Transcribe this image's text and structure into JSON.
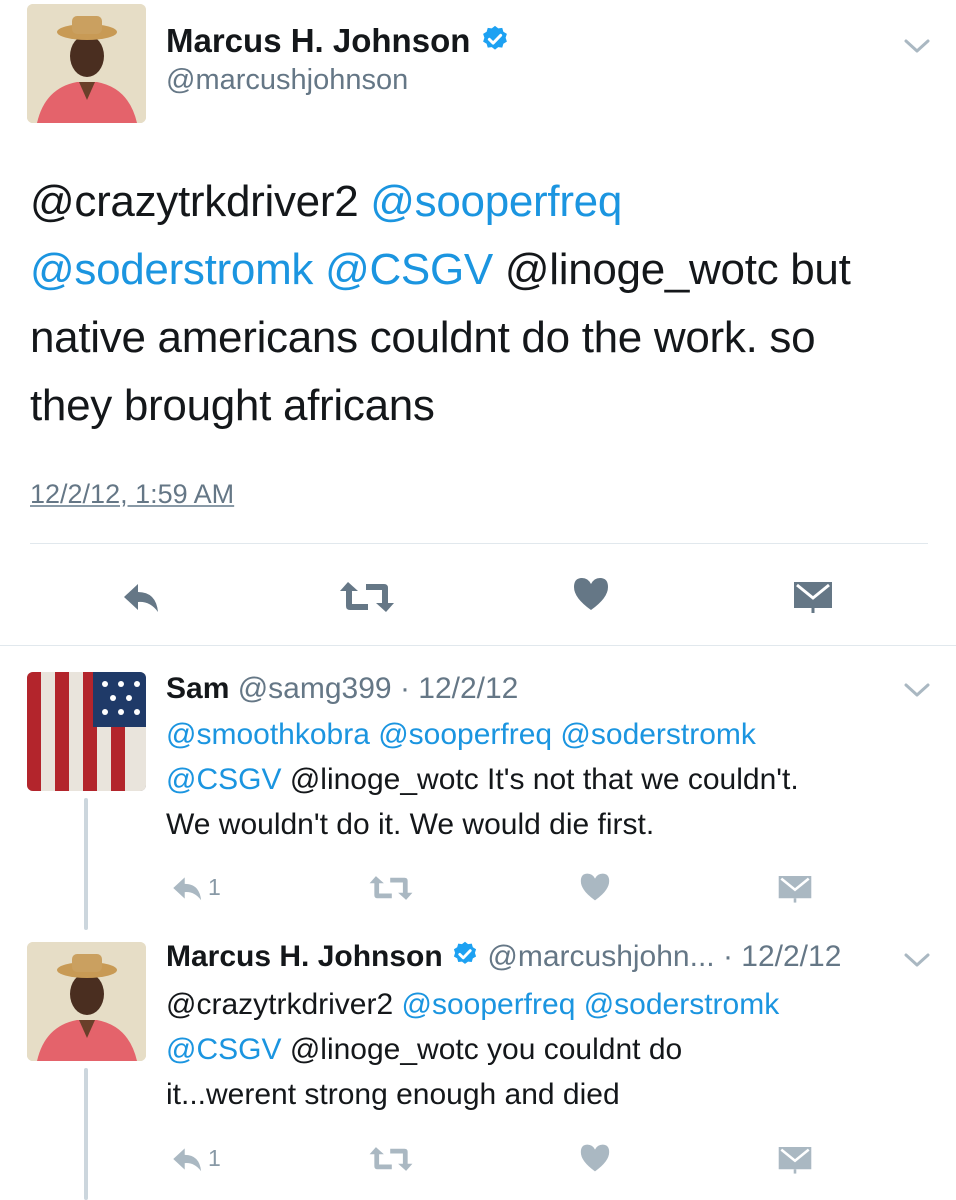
{
  "main_tweet": {
    "display_name": "Marcus H. Johnson",
    "handle": "@marcushjohnson",
    "text_parts": [
      {
        "t": "@crazytrkdriver2",
        "link": false
      },
      {
        "t": "@sooperfreq",
        "link": true
      },
      {
        "t": "@soderstromk",
        "link": true
      },
      {
        "t": "@CSGV",
        "link": true
      },
      {
        "t": "@linoge_wotc but",
        "link": false
      }
    ],
    "text_line3": "native americans couldnt do the work. so",
    "text_line4": "they brought africans",
    "timestamp": "12/2/12, 1:59 AM"
  },
  "replies": [
    {
      "display_name": "Sam",
      "handle": "@samg399",
      "date": "· 12/2/12",
      "line1": "@smoothkobra @sooperfreq @soderstromk",
      "line2_link": "@CSGV",
      "line2_rest": " @linoge_wotc It's not that we couldn't.",
      "line3": "We wouldn't do it. We would die first.",
      "reply_count": "1"
    },
    {
      "display_name": "Marcus H. Johnson",
      "handle": "@marcushjohn...",
      "date": "· 12/2/12",
      "line1_plain": "@crazytrkdriver2 ",
      "line1_link": "@sooperfreq @soderstromk",
      "line2_link": "@CSGV",
      "line2_rest": " @linoge_wotc you couldnt do",
      "line3": "it...werent strong enough and died",
      "reply_count": "1"
    }
  ],
  "colors": {
    "link": "#1b95e0",
    "icon": "#657786",
    "icon_light": "#aab8c2",
    "divider": "#e1e8ed"
  },
  "icons": [
    "reply-icon",
    "retweet-icon",
    "like-icon",
    "message-icon",
    "chevron-down-icon",
    "verified-badge-icon"
  ]
}
